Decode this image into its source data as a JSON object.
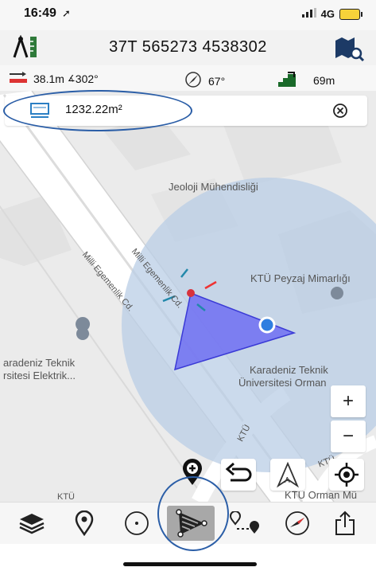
{
  "status_bar": {
    "time": "16:49",
    "network": "4G"
  },
  "header": {
    "coordinates": "37T 565273 4538302"
  },
  "stats": {
    "distance": "38.1m",
    "bearing": "302°",
    "heading": "67°",
    "altitude": "69m"
  },
  "area": {
    "value": "1232.22m²"
  },
  "map": {
    "labels": {
      "geology": "Jeoloji Mühendisliği",
      "street1": "Milli Egemenlik Cd.",
      "street2": "Milli Egemenlik Cd.",
      "landscape": "KTÜ Peyzaj Mimarlığı",
      "karadeniz_left_1": "aradeniz Teknik",
      "karadeniz_left_2": "rsitesi Elektrik...",
      "karadeniz_right_1": "Karadeniz Teknik",
      "karadeniz_right_2": "Üniversitesi Orman",
      "ktu_road": "KTÜ",
      "ktu_road2": "KTÜ",
      "ktu_bottom": "KTÜ",
      "orman_bottom": "KTÜ Orman Mü"
    },
    "zoom_in": "+",
    "zoom_out": "−"
  },
  "colors": {
    "accent": "#2b5ea7",
    "polygon_fill": "#6f6ff2",
    "circle_fill": "#b9cde6"
  }
}
